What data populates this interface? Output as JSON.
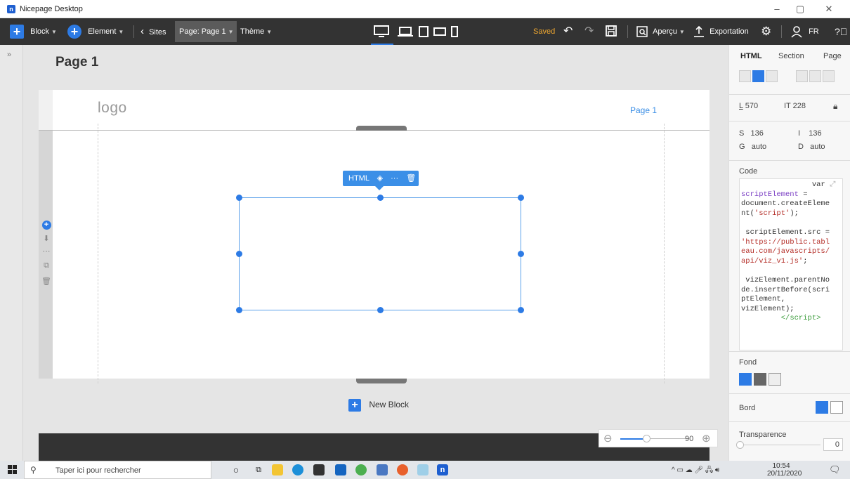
{
  "window": {
    "title": "Nicepage Desktop",
    "minimize": "–",
    "maximize": "▢",
    "close": "✕"
  },
  "toolbar": {
    "block_label": "Block",
    "element_label": "Element",
    "sites_label": "Sites",
    "page_label": "Page: Page 1",
    "theme_label": "Thème",
    "saved_label": "Saved",
    "preview_label": "Aperçu",
    "export_label": "Exportation",
    "lang_label": "FR"
  },
  "canvas": {
    "page_title": "Page 1",
    "logo_text": "logo",
    "nav_item": "Page 1",
    "html_toolbar_label": "HTML",
    "new_block_label": "New Block"
  },
  "zoom": {
    "value": "90"
  },
  "panel": {
    "tabs": [
      "HTML",
      "Section",
      "Page"
    ],
    "active_tab": "HTML",
    "left_label": "L",
    "left_value": "570",
    "top_label": "IT",
    "top_value": "228",
    "s_label": "S",
    "s_value": "136",
    "i_label": "I",
    "i_value": "136",
    "g_label": "G",
    "g_value": "auto",
    "d_label": "D",
    "d_value": "auto",
    "code_label": "Code",
    "background_label": "Fond",
    "border_label": "Bord",
    "transparency_label": "Transparence",
    "transparency_value": "0"
  },
  "taskbar": {
    "search_placeholder": "Taper ici pour rechercher",
    "time": "10:54",
    "date": "20/11/2020"
  },
  "colors": {
    "accent": "#2d7be5",
    "toolbar": "#333333",
    "saved": "#f0a830",
    "nav_link": "#3a8ee6"
  }
}
